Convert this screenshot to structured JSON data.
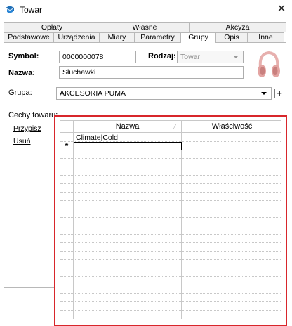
{
  "window": {
    "title": "Towar",
    "close_glyph": "✕",
    "app_icon": "app-logo-icon"
  },
  "tabs": {
    "row1": [
      "Opłaty",
      "Własne",
      "Akcyza"
    ],
    "row2": [
      "Podstawowe",
      "Urządzenia",
      "Miary",
      "Parametry",
      "Grupy",
      "Opis",
      "Inne"
    ],
    "active": "Grupy"
  },
  "form": {
    "symbol_label": "Symbol:",
    "symbol_value": "0000000078",
    "rodzaj_label": "Rodzaj:",
    "rodzaj_value": "Towar",
    "nazwa_label": "Nazwa:",
    "nazwa_value": "Słuchawki",
    "grupa_label": "Grupa:",
    "grupa_value": "AKCESORIA PUMA",
    "plus_label": "+",
    "cechy_label": "Cechy towaru:",
    "przypisz_link": "Przypisz",
    "usun_link": "Usuń"
  },
  "product_image": "headphones-icon",
  "grid": {
    "columns": [
      "Nazwa",
      "Właściwość"
    ],
    "rows": [
      {
        "sel": "",
        "nazwa": "Climate|Cold",
        "wlasciwosc": ""
      },
      {
        "sel": "*",
        "nazwa": "",
        "wlasciwosc": ""
      }
    ]
  },
  "colors": {
    "highlight_border": "#d8262b"
  }
}
